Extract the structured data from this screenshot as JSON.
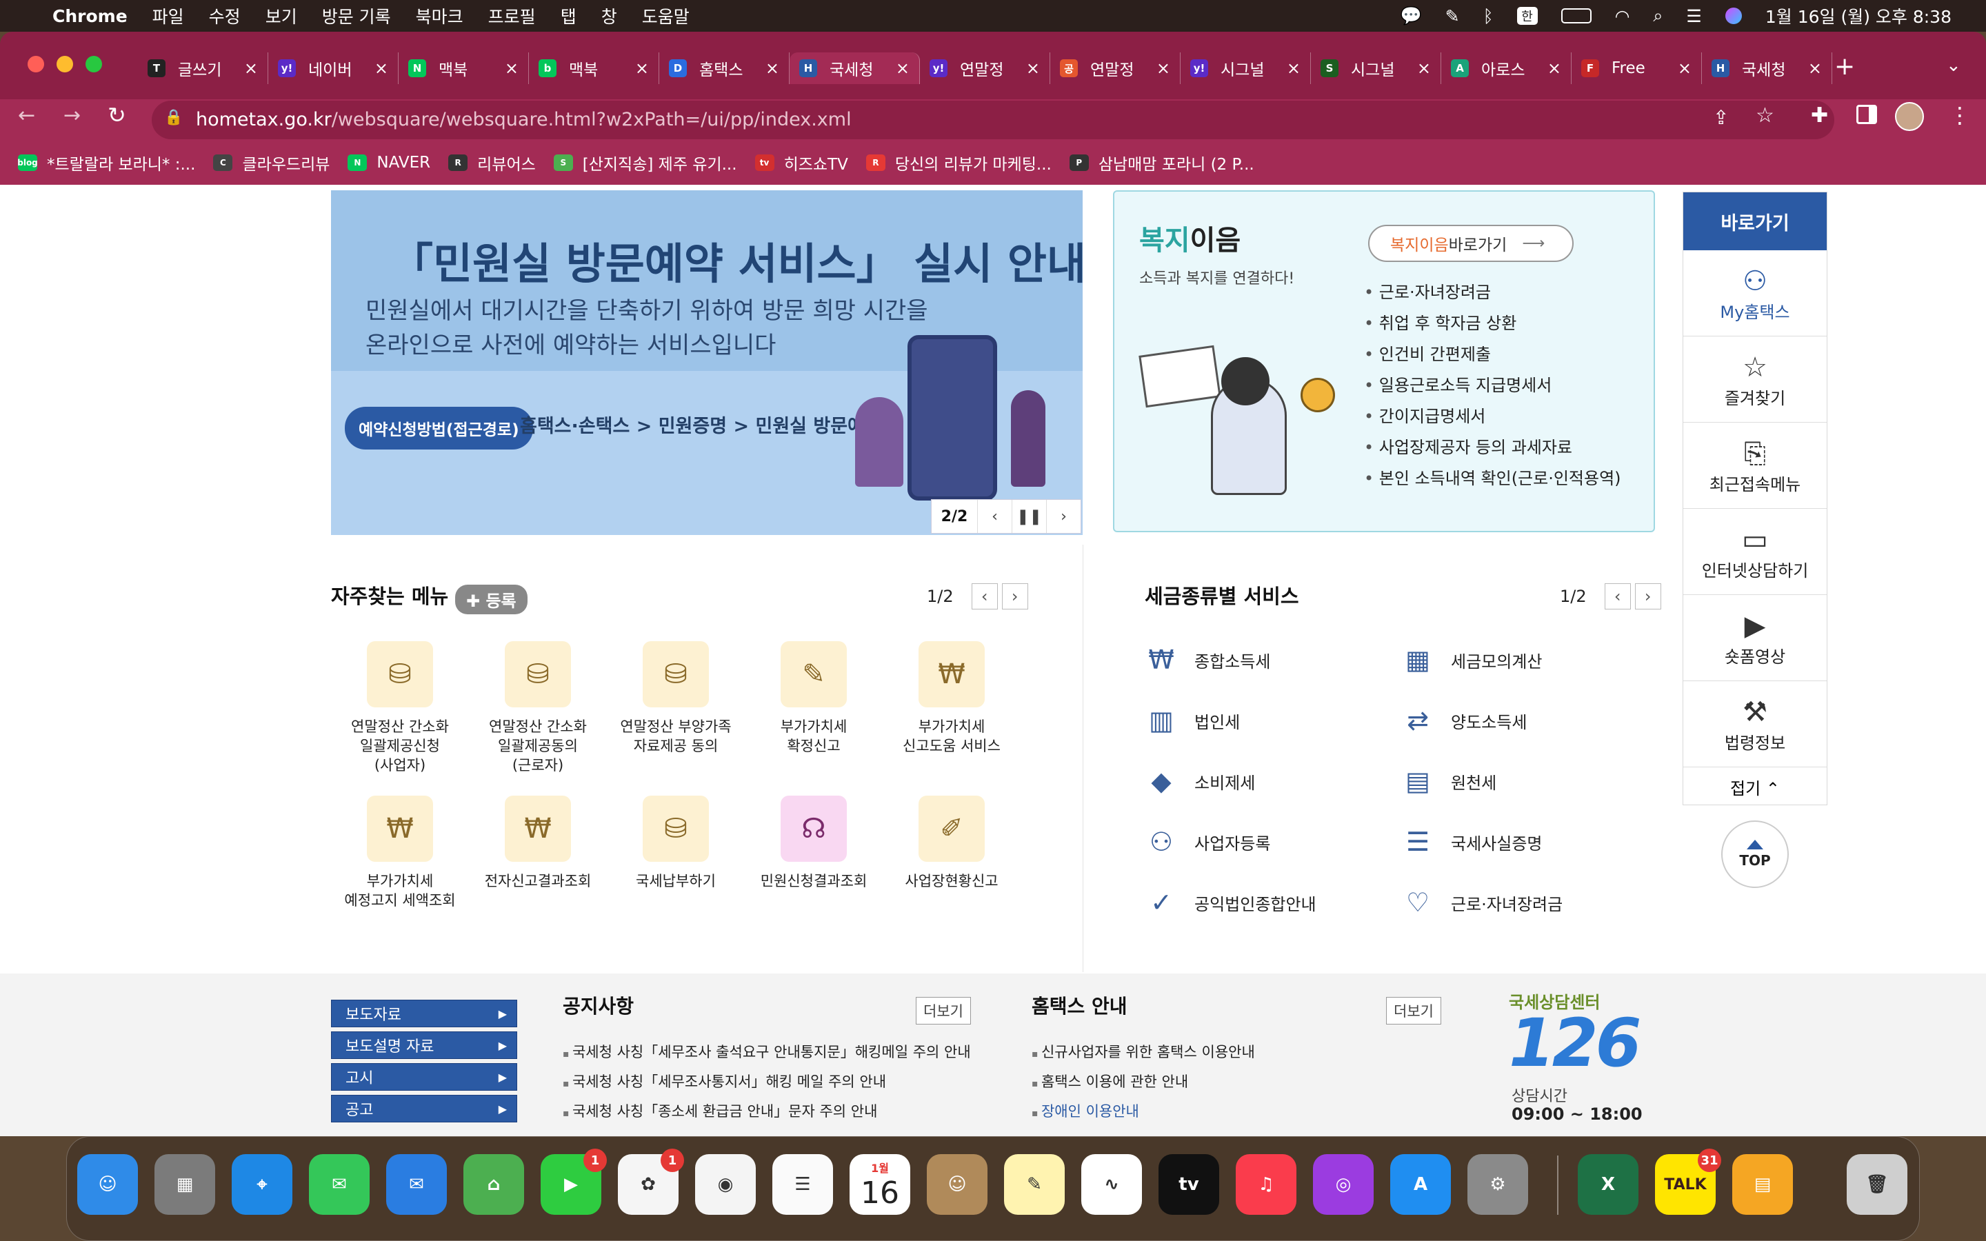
{
  "menubar": {
    "app": "Chrome",
    "items": [
      "파일",
      "수정",
      "보기",
      "방문 기록",
      "북마크",
      "프로필",
      "탭",
      "창",
      "도움말"
    ],
    "input_indicator": "한",
    "datetime": "1월 16일 (월) 오후 8:38"
  },
  "tabs": [
    {
      "label": "글쓰기",
      "fav": "T",
      "color": "#222222"
    },
    {
      "label": "네이버",
      "fav": "y!",
      "color": "#5b2bc7"
    },
    {
      "label": "맥북 ",
      "fav": "N",
      "color": "#03c75a"
    },
    {
      "label": "맥북 ",
      "fav": "b",
      "color": "#03c75a"
    },
    {
      "label": "홈택스",
      "fav": "D",
      "color": "#2b6cdf"
    },
    {
      "label": "국세청",
      "fav": "H",
      "color": "#2b5aa4"
    },
    {
      "label": "연말정",
      "fav": "y!",
      "color": "#5b2bc7"
    },
    {
      "label": "연말정",
      "fav": "공",
      "color": "#e4572e"
    },
    {
      "label": "시그널",
      "fav": "y!",
      "color": "#5b2bc7"
    },
    {
      "label": "시그널",
      "fav": "S",
      "color": "#1b5e20"
    },
    {
      "label": "아로스",
      "fav": "A",
      "color": "#1aa37a"
    },
    {
      "label": "Free",
      "fav": "F",
      "color": "#c62828"
    },
    {
      "label": "국세청",
      "fav": "H",
      "color": "#2b5aa4"
    }
  ],
  "url": {
    "host": "hometax.go.kr",
    "path": "/websquare/websquare.html?w2xPath=/ui/pp/index.xml"
  },
  "bookmarks": [
    {
      "label": "*트랄랄라 보라니* :...",
      "color": "#03c75a",
      "fav": "blog"
    },
    {
      "label": "클라우드리뷰",
      "color": "#444444",
      "fav": "C"
    },
    {
      "label": "NAVER",
      "color": "#03c75a",
      "fav": "N"
    },
    {
      "label": "리뷰어스",
      "color": "#333333",
      "fav": "R"
    },
    {
      "label": "[산지직송] 제주 유기...",
      "color": "#4caf50",
      "fav": "S"
    },
    {
      "label": "히즈쇼TV",
      "color": "#d32f2f",
      "fav": "tv"
    },
    {
      "label": "당신의 리뷰가 마케팅...",
      "color": "#e53935",
      "fav": "R"
    },
    {
      "label": "삼남매맘 포라니 (2 P...",
      "color": "#333333",
      "fav": "P"
    }
  ],
  "banner": {
    "headline": "「민원실 방문예약 서비스」 실시 안내",
    "line1": "민원실에서 대기시간을 단축하기 위하여 방문 희망 시간을",
    "line2": "온라인으로 사전에 예약하는 서비스입니다",
    "pill": "예약신청방법(접근경로)",
    "path": "홈택스·손택스 > 민원증명 > 민원실 방문예약",
    "page": "2/2"
  },
  "welfare": {
    "title_a": "복지",
    "title_b": "이음",
    "subtitle": "소득과 복지를 연결하다!",
    "btn_a": "복지이음",
    "btn_b": " 바로가기",
    "items": [
      "근로·자녀장려금",
      "취업 후 학자금 상환",
      "인건비 간편제출",
      "일용근로소득 지급명세서",
      "간이지급명세서",
      "사업장제공자 등의 과세자료",
      "본인 소득내역 확인(근로·인적용역)"
    ]
  },
  "quick": {
    "title": "바로가기",
    "items": [
      {
        "label": "My홈택스",
        "icon": "person-icon"
      },
      {
        "label": "즐겨찾기",
        "icon": "star-icon"
      },
      {
        "label": "최근접속메뉴",
        "icon": "search-doc-icon"
      },
      {
        "label": "인터넷상담하기",
        "icon": "laptop-icon"
      },
      {
        "label": "숏폼영상",
        "icon": "play-icon"
      },
      {
        "label": "법령정보",
        "icon": "gavel-icon"
      }
    ],
    "fold": "접기 ⌃",
    "top": "TOP"
  },
  "freq": {
    "title": "자주찾는 메뉴",
    "register": "✚ 등록",
    "page": "1/2",
    "items": [
      {
        "label": "연말정산 간소화\n일괄제공신청\n(사업자)",
        "icon": "tax-bag-icon"
      },
      {
        "label": "연말정산 간소화\n일괄제공동의\n(근로자)",
        "icon": "tax-bag-icon"
      },
      {
        "label": "연말정산 부양가족\n자료제공 동의",
        "icon": "tax-bag-icon"
      },
      {
        "label": "부가가치세\n확정신고",
        "icon": "vat-icon"
      },
      {
        "label": "부가가치세\n신고도움 서비스",
        "icon": "won-search-icon"
      },
      {
        "label": "부가가치세\n예정고지 세액조회",
        "icon": "won-search-icon"
      },
      {
        "label": "전자신고결과조회",
        "icon": "won-search-icon"
      },
      {
        "label": "국세납부하기",
        "icon": "tax-bag-icon"
      },
      {
        "label": "민원신청결과조회",
        "icon": "headset-icon"
      },
      {
        "label": "사업장현황신고",
        "icon": "edit-icon"
      }
    ]
  },
  "taxsvc": {
    "title": "세금종류별 서비스",
    "page": "1/2",
    "items": [
      {
        "label": "종합소득세",
        "icon": "wallet-icon"
      },
      {
        "label": "세금모의계산",
        "icon": "calculator-icon"
      },
      {
        "label": "법인세",
        "icon": "building-icon"
      },
      {
        "label": "양도소득세",
        "icon": "transfer-doc-icon"
      },
      {
        "label": "소비제세",
        "icon": "diamond-icon"
      },
      {
        "label": "원천세",
        "icon": "invoice-icon"
      },
      {
        "label": "사업자등록",
        "icon": "person-icon"
      },
      {
        "label": "국세사실증명",
        "icon": "document-icon"
      },
      {
        "label": "공익법인종합안내",
        "icon": "clipboard-icon"
      },
      {
        "label": "근로·자녀장려금",
        "icon": "heart-hands-icon"
      }
    ]
  },
  "footer": {
    "buttons": [
      "보도자료",
      "보도설명 자료",
      "고시",
      "공고"
    ],
    "notice_title": "공지사항",
    "more": "더보기",
    "notices": [
      "국세청 사칭「세무조사 출석요구 안내통지문」해킹메일 주의 안내",
      "국세청 사칭「세무조사통지서」해킹 메일 주의 안내",
      "국세청 사칭「종소세 환급금 안내」문자 주의 안내"
    ],
    "guide_title": "홈택스 안내",
    "guides": [
      "신규사업자를 위한 홈택스 이용안내",
      "홈택스 이용에 관한 안내",
      "장애인 이용안내"
    ],
    "center_label": "국세상담센터",
    "center_number": "126",
    "hours_label": "상담시간",
    "hours": "09:00 ~ 18:00"
  },
  "dock": {
    "facetime_badge": "1",
    "photos_badge": "1",
    "talk_badge": "31",
    "calendar_month": "1월",
    "calendar_day": "16",
    "talk": "TALK",
    "tv": "tv"
  }
}
